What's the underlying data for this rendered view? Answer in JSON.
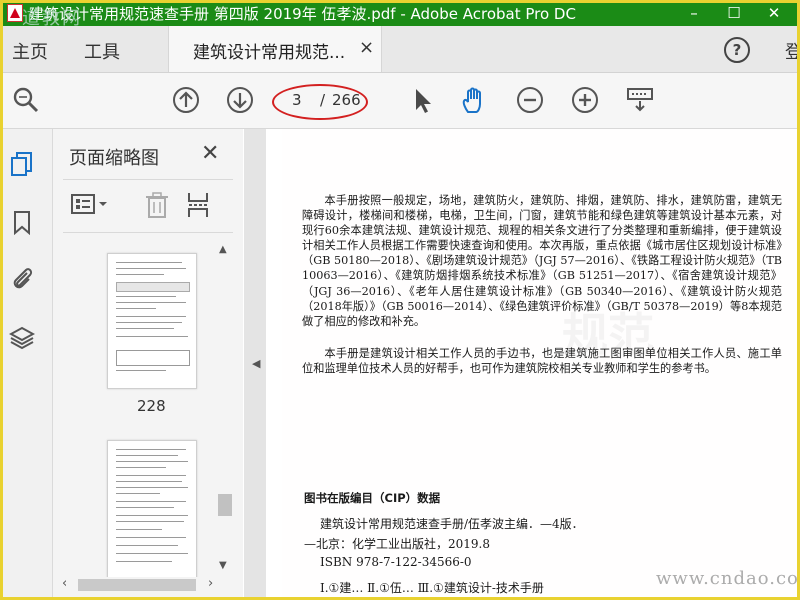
{
  "titlebar": {
    "title": "建筑设计常用规范速查手册 第四版 2019年 伍孝波.pdf - Adobe Acrobat Pro DC",
    "watermark": "道教网",
    "minimize": "–",
    "maximize": "☐",
    "close": "✕"
  },
  "menubar": {
    "home": "主页",
    "tools": "工具",
    "doc_tab": "建筑设计常用规范...",
    "tab_close": "×",
    "help": "?",
    "signin": "登"
  },
  "toolbar": {
    "current_page": "3",
    "page_separator": "/",
    "total_pages": "266"
  },
  "thumbnails_panel": {
    "title": "页面缩略图",
    "close": "✕",
    "first_thumb_page": "228"
  },
  "document": {
    "paragraph1": "本手册按照一般规定，场地，建筑防火，建筑防、排烟，建筑防、排水，建筑防雷，建筑无障碍设计，楼梯间和楼梯，电梯，卫生间，门窗，建筑节能和绿色建筑等建筑设计基本元素，对现行60余本建筑法规、建筑设计规范、规程的相关条文进行了分类整理和重新编排，便于建筑设计相关工作人员根据工作需要快速查询和使用。本次再版，重点依据《城市居住区规划设计标准》（GB 50180—2018）、《剧场建筑设计规范》（JGJ 57—2016）、《铁路工程设计防火规范》（TB 10063—2016）、《建筑防烟排烟系统技术标准》（GB 51251—2017）、《宿舍建筑设计规范》（JGJ 36—2016）、《老年人居住建筑设计标准》（GB 50340—2016）、《建筑设计防火规范（2018年版）》（GB 50016—2014）、《绿色建筑评价标准》（GB/T 50378—2019）等8本规范做了相应的修改和补充。",
    "paragraph2": "本手册是建筑设计相关工作人员的手边书，也是建筑施工图审图单位相关工作人员、施工单位和监理单位技术人员的好帮手，也可作为建筑院校相关专业教师和学生的参考书。",
    "cip_heading": "图书在版编目（CIP）数据",
    "cip_line1": "建筑设计常用规范速查手册/伍孝波主编．—4版．",
    "cip_line2": "—北京：化学工业出版社，2019.8",
    "cip_line3": "ISBN 978-7-122-34566-0",
    "cip_line4": "Ⅰ.①建…  Ⅱ.①伍…  Ⅲ.①建筑设计-技术手册"
  },
  "watermark_br": "www.cndao.com",
  "colors": {
    "titlebar_bg": "#1b8b16",
    "accent_blue": "#1a73c8",
    "annotation_red": "#d32020",
    "frame_yellow": "#e9d230"
  }
}
